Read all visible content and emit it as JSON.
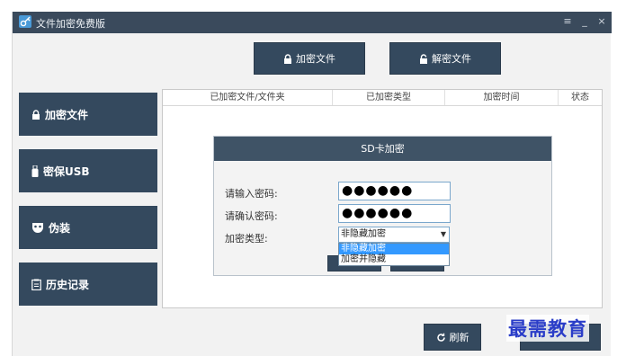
{
  "window": {
    "title": "文件加密免费版",
    "controls": {
      "menu": "≡",
      "minimize": "_",
      "close": "×"
    }
  },
  "toolbar": {
    "encrypt_label": "加密文件",
    "decrypt_label": "解密文件"
  },
  "sidebar": {
    "items": [
      {
        "label": "加密文件",
        "icon": "lock-icon"
      },
      {
        "label": "密保USB",
        "icon": "usb-icon"
      },
      {
        "label": "伪装",
        "icon": "mask-icon"
      },
      {
        "label": "历史记录",
        "icon": "history-icon"
      }
    ]
  },
  "table": {
    "columns": [
      "已加密文件/文件夹",
      "已加密类型",
      "加密时间",
      "状态"
    ]
  },
  "dialog": {
    "title": "SD卡加密",
    "password_label": "请输入密码:",
    "password_value": "●●●●●●",
    "confirm_label": "请确认密码:",
    "confirm_value": "●●●●●●",
    "type_label": "加密类型:",
    "type_selected": "非隐藏加密",
    "type_options": [
      "非隐藏加密",
      "加密并隐藏"
    ]
  },
  "footer": {
    "refresh_label": "刷新"
  },
  "watermark": "最需教育",
  "colors": {
    "titlebar": "#3a4a5c",
    "button": "#34495e",
    "dialog_header": "#3f5366",
    "selection": "#3399ff",
    "watermark": "#2a3dc8"
  }
}
